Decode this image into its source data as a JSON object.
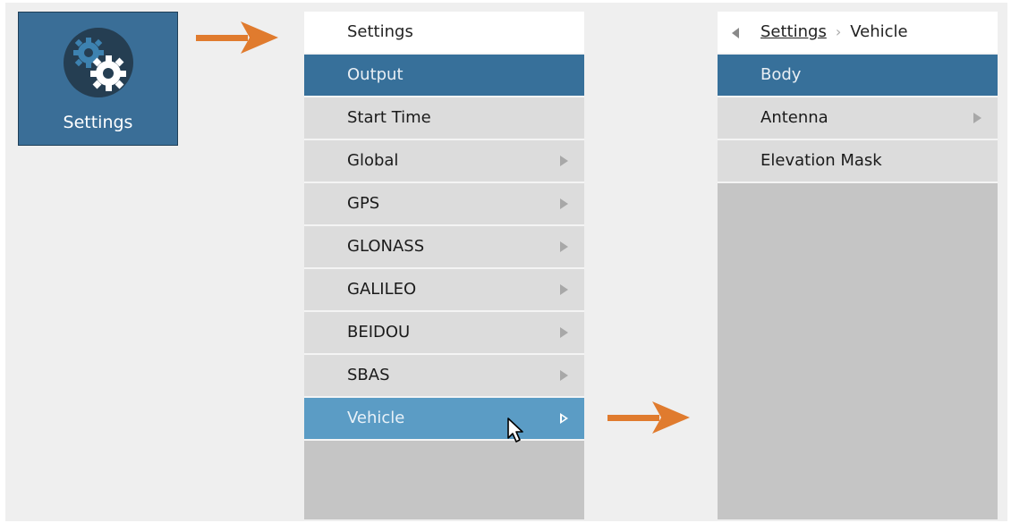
{
  "launcher": {
    "label": "Settings",
    "icon": "gears-icon"
  },
  "menu": {
    "header": "Settings",
    "items": [
      {
        "label": "Output",
        "has_submenu": false,
        "state": "selected"
      },
      {
        "label": "Start Time",
        "has_submenu": false,
        "state": "normal"
      },
      {
        "label": "Global",
        "has_submenu": true,
        "state": "normal"
      },
      {
        "label": "GPS",
        "has_submenu": true,
        "state": "normal"
      },
      {
        "label": "GLONASS",
        "has_submenu": true,
        "state": "normal"
      },
      {
        "label": "GALILEO",
        "has_submenu": true,
        "state": "normal"
      },
      {
        "label": "BEIDOU",
        "has_submenu": true,
        "state": "normal"
      },
      {
        "label": "SBAS",
        "has_submenu": true,
        "state": "normal"
      },
      {
        "label": "Vehicle",
        "has_submenu": true,
        "state": "hover"
      }
    ]
  },
  "submenu": {
    "breadcrumb": {
      "parent": "Settings",
      "current": "Vehicle"
    },
    "items": [
      {
        "label": "Body",
        "has_submenu": false,
        "state": "selected"
      },
      {
        "label": "Antenna",
        "has_submenu": true,
        "state": "normal"
      },
      {
        "label": "Elevation Mask",
        "has_submenu": false,
        "state": "normal"
      }
    ]
  },
  "colors": {
    "selected": "#37709a",
    "hover": "#5b9cc5",
    "arrow": "#e07b2e",
    "tile": "#3a6e97"
  }
}
